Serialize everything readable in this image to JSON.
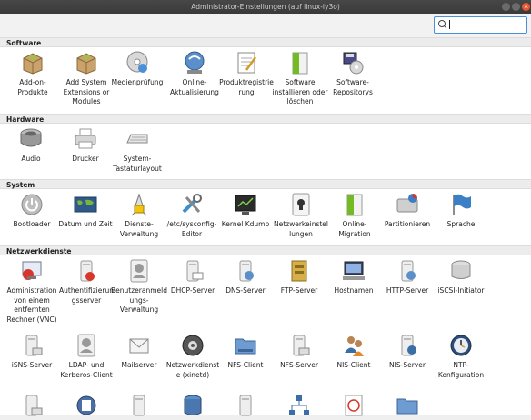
{
  "window": {
    "title": "Administrator-Einstellungen (auf linux-iy3o)"
  },
  "search": {
    "placeholder": "",
    "value": ""
  },
  "sections": {
    "software": {
      "title": "Software",
      "items": [
        {
          "label": "Add-on-Produkte",
          "icon": "package-icon"
        },
        {
          "label": "Add System Extensions or Modules",
          "icon": "package-icon"
        },
        {
          "label": "Medienprüfung",
          "icon": "disc-check-icon"
        },
        {
          "label": "Online-Aktualisierung",
          "icon": "online-update-icon"
        },
        {
          "label": "Produktregistrierung",
          "icon": "registration-icon"
        },
        {
          "label": "Software installieren oder löschen",
          "icon": "software-install-icon"
        },
        {
          "label": "Software-Repositorys",
          "icon": "repository-icon"
        }
      ]
    },
    "hardware": {
      "title": "Hardware",
      "items": [
        {
          "label": "Audio",
          "icon": "speaker-icon"
        },
        {
          "label": "Drucker",
          "icon": "printer-icon"
        },
        {
          "label": "System-Tastaturlayout",
          "icon": "keyboard-icon"
        }
      ]
    },
    "system": {
      "title": "System",
      "items": [
        {
          "label": "Bootloader",
          "icon": "power-icon"
        },
        {
          "label": "Datum und Zeit",
          "icon": "world-map-icon"
        },
        {
          "label": "Dienste-Verwaltung",
          "icon": "services-icon"
        },
        {
          "label": "/etc/sysconfig-Editor",
          "icon": "tools-icon"
        },
        {
          "label": "Kernel Kdump",
          "icon": "monitor-chart-icon"
        },
        {
          "label": "Netzwerkeinstellungen",
          "icon": "network-settings-icon"
        },
        {
          "label": "Online-Migration",
          "icon": "migration-icon"
        },
        {
          "label": "Partitionieren",
          "icon": "harddisk-icon"
        },
        {
          "label": "Sprache",
          "icon": "flag-icon"
        }
      ]
    },
    "netzwerkdienste": {
      "title": "Netzwerkdienste",
      "items": [
        {
          "label": "Administration von einem entfernten Rechner (VNC)",
          "icon": "remote-admin-icon"
        },
        {
          "label": "Authentifizierungsserver",
          "icon": "auth-server-icon"
        },
        {
          "label": "Benutzeranmeldungs-Verwaltung",
          "icon": "login-management-icon"
        },
        {
          "label": "DHCP-Server",
          "icon": "dhcp-server-icon"
        },
        {
          "label": "DNS-Server",
          "icon": "dns-server-icon"
        },
        {
          "label": "FTP-Server",
          "icon": "ftp-server-icon"
        },
        {
          "label": "Hostnamen",
          "icon": "hostname-icon"
        },
        {
          "label": "HTTP-Server",
          "icon": "http-server-icon"
        },
        {
          "label": "iSCSI-Initiator",
          "icon": "iscsi-icon"
        },
        {
          "label": "iSNS-Server",
          "icon": "isns-server-icon"
        },
        {
          "label": "LDAP- und Kerberos-Client",
          "icon": "ldap-client-icon"
        },
        {
          "label": "Mailserver",
          "icon": "mail-server-icon"
        },
        {
          "label": "Netzwerkdienste (xinetd)",
          "icon": "xinetd-icon"
        },
        {
          "label": "NFS-Client",
          "icon": "nfs-client-icon"
        },
        {
          "label": "NFS-Server",
          "icon": "nfs-server-icon"
        },
        {
          "label": "NIS-Client",
          "icon": "nis-client-icon"
        },
        {
          "label": "NIS-Server",
          "icon": "nis-server-icon"
        },
        {
          "label": "NTP-Konfiguration",
          "icon": "ntp-icon"
        }
      ]
    }
  },
  "colors": {
    "accent": "#4a90d9",
    "close": "#e8562d",
    "titlebar": "#3c3c3c"
  }
}
